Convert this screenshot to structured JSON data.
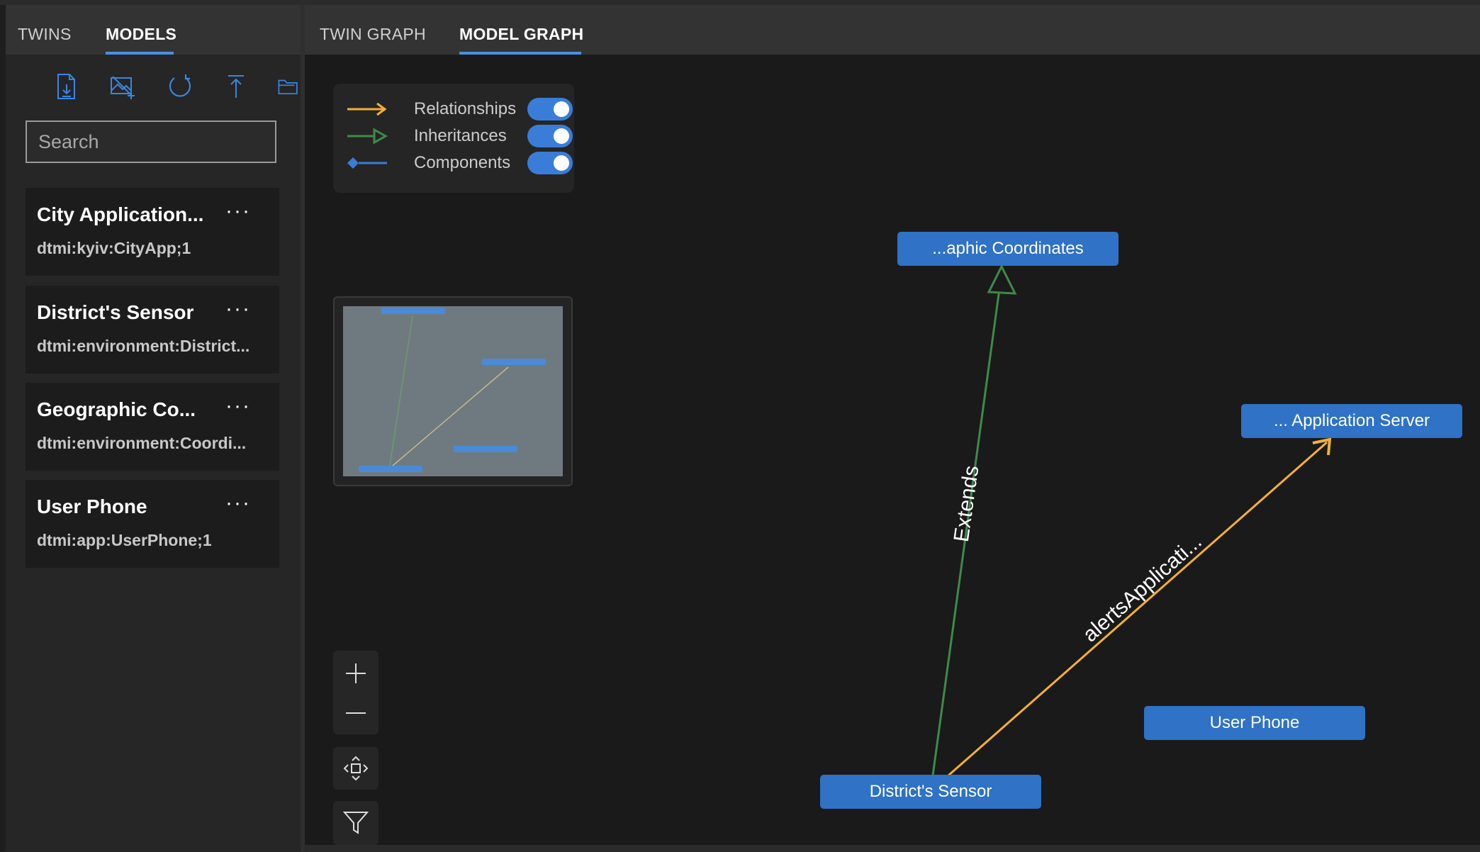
{
  "left_tabs": [
    {
      "label": "TWINS",
      "active": false
    },
    {
      "label": "MODELS",
      "active": true
    }
  ],
  "right_tabs": [
    {
      "label": "TWIN GRAPH",
      "active": false
    },
    {
      "label": "MODEL GRAPH",
      "active": true
    }
  ],
  "toolbar": {
    "icons": [
      "upload-model-icon",
      "upload-image-icon",
      "refresh-icon",
      "import-icon",
      "folder-icon"
    ]
  },
  "search": {
    "placeholder": "Search"
  },
  "models": [
    {
      "title": "City Application...",
      "id": "dtmi:kyiv:CityApp;1",
      "more": "···"
    },
    {
      "title": "District's Sensor",
      "id": "dtmi:environment:District...",
      "more": "···"
    },
    {
      "title": "Geographic Co...",
      "id": "dtmi:environment:Coordi...",
      "more": "···"
    },
    {
      "title": "User Phone",
      "id": "dtmi:app:UserPhone;1",
      "more": "···"
    }
  ],
  "legend": [
    {
      "label": "Relationships",
      "color": "#f2b134",
      "enabled": true
    },
    {
      "label": "Inheritances",
      "color": "#3f8a4a",
      "enabled": true
    },
    {
      "label": "Components",
      "color": "#3a7dd8",
      "enabled": true
    }
  ],
  "graph": {
    "nodes": {
      "coordinates": "...aphic Coordinates",
      "app_server": "... Application Server",
      "user_phone": "User Phone",
      "district_sensor": "District's Sensor"
    },
    "edges": {
      "extends": "Extends",
      "alerts": "alertsApplicati..."
    }
  },
  "controls": [
    "zoom-in-icon",
    "zoom-out-icon",
    "center-icon",
    "filter-icon"
  ],
  "colors": {
    "accent": "#4a90e2",
    "node": "#2f72c6",
    "relationship": "#f2b134",
    "inheritance": "#3f8a4a"
  }
}
